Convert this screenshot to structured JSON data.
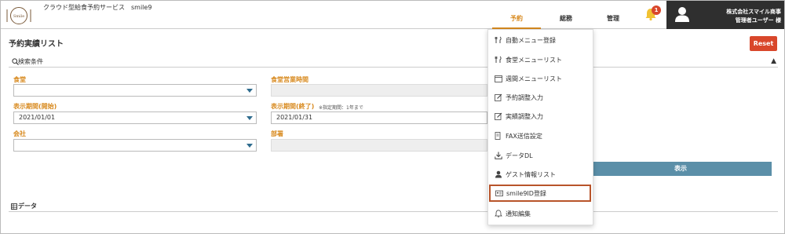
{
  "app": {
    "logo_text": "Smile",
    "title": "クラウド型給食予約サービス　smile9"
  },
  "nav": {
    "items": [
      {
        "label": "予約"
      },
      {
        "label": "総務"
      },
      {
        "label": "管理"
      }
    ],
    "notification_count": "1"
  },
  "user": {
    "company": "株式会社スマイル商事",
    "name": "管理者ユーザー 様"
  },
  "page": {
    "title": "予約実績リスト",
    "reset_label": "Reset"
  },
  "search": {
    "section_label": "検索条件",
    "fields": {
      "cafeteria_label": "食堂",
      "cafeteria_value": "",
      "hours_label": "食堂営業時間",
      "start_label": "表示期間(開始)",
      "start_value": "2021/01/01",
      "end_label": "表示期間(終了)",
      "end_hint": "※指定期間：1年まで",
      "end_value": "2021/01/31",
      "company_label": "会社",
      "company_value": "",
      "dept_label": "部署"
    },
    "submit_label": "表示"
  },
  "data_section": {
    "label": "データ"
  },
  "dropdown": {
    "items": [
      {
        "label": "自動メニュー登録",
        "icon": "fork-knife-icon"
      },
      {
        "label": "食堂メニューリスト",
        "icon": "fork-knife-icon"
      },
      {
        "label": "週間メニューリスト",
        "icon": "calendar-icon"
      },
      {
        "label": "予約調整入力",
        "icon": "edit-icon"
      },
      {
        "label": "実績調整入力",
        "icon": "edit-icon"
      },
      {
        "label": "FAX送信設定",
        "icon": "fax-icon"
      },
      {
        "label": "データDL",
        "icon": "download-icon"
      },
      {
        "label": "ゲスト情報リスト",
        "icon": "guest-icon"
      },
      {
        "label": "smile9ID登録",
        "icon": "id-card-icon"
      },
      {
        "label": "通知編集",
        "icon": "bell-icon"
      }
    ],
    "highlight_color": "#b8542a"
  },
  "colors": {
    "accent": "#d88a1f",
    "reset": "#d9472b",
    "submit": "#5b8fa8",
    "user_panel": "#2f2f2f"
  }
}
